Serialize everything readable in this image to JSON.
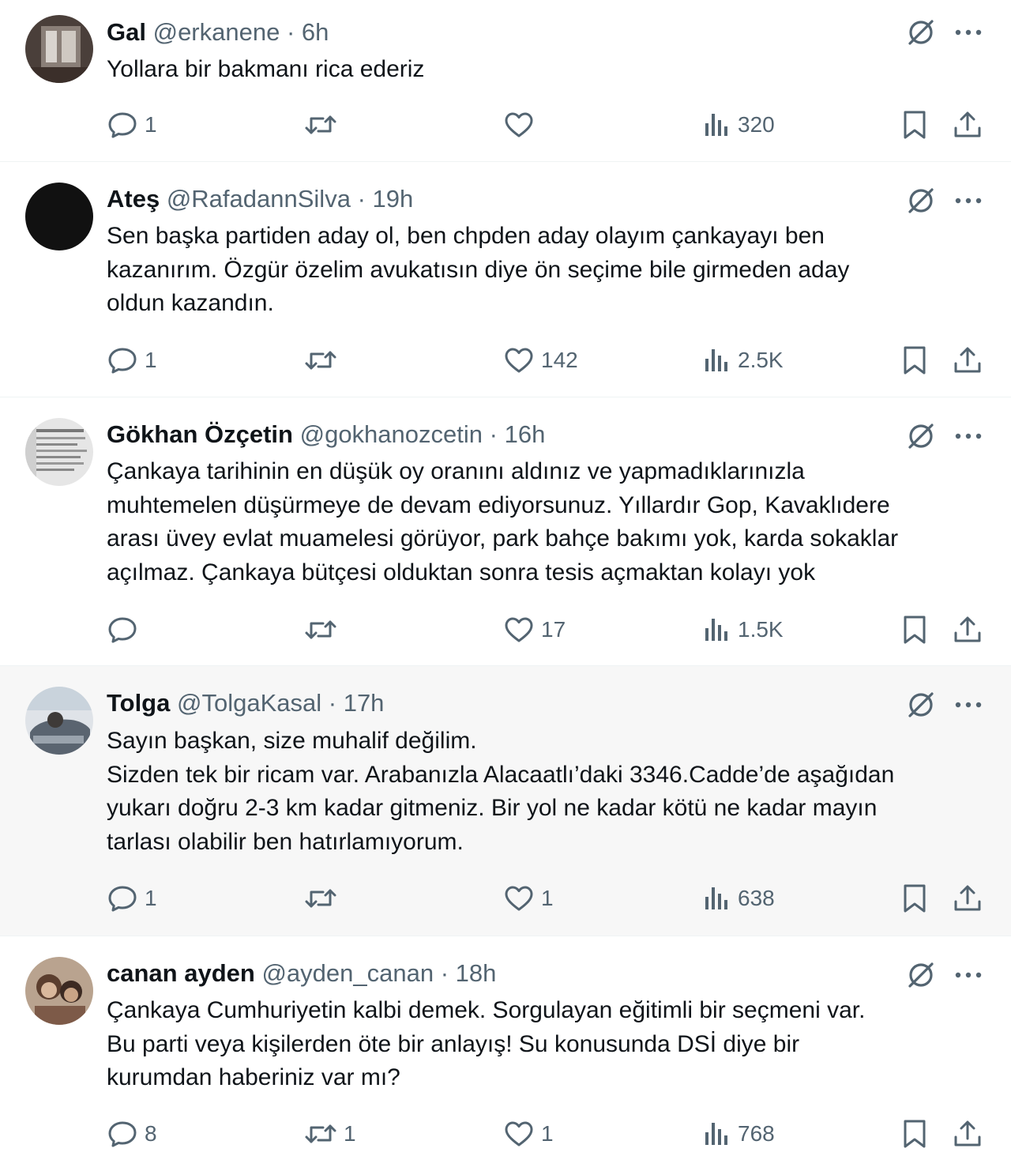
{
  "tweets": [
    {
      "name": "Gal",
      "handle": "@erkanene",
      "sep": "·",
      "time": "6h",
      "lines": [
        "Yollara bir bakmanı rica ederiz"
      ],
      "replies": "1",
      "retweets": "",
      "likes": "",
      "views": "320",
      "avatar": "photo"
    },
    {
      "name": "Ateş",
      "handle": "@RafadannSilva",
      "sep": "·",
      "time": "19h",
      "lines": [
        "Sen başka partiden aday ol, ben chpden aday olayım çankayayı ben",
        "kazanırım. Özgür özelim avukatısın diye ön seçime bile girmeden aday",
        "oldun kazandın."
      ],
      "replies": "1",
      "retweets": "",
      "likes": "142",
      "views": "2.5K",
      "avatar": "dark"
    },
    {
      "name": "Gökhan Özçetin",
      "handle": "@gokhanozcetin",
      "sep": "·",
      "time": "16h",
      "lines": [
        "Çankaya tarihinin en düşük oy oranını aldınız ve yapmadıklarınızla",
        "muhtemelen düşürmeye de devam ediyorsunuz. Yıllardır Gop, Kavaklıdere",
        "arası üvey evlat muamelesi görüyor, park bahçe bakımı yok, karda sokaklar",
        "açılmaz. Çankaya bütçesi olduktan sonra tesis açmaktan kolayı yok"
      ],
      "replies": "",
      "retweets": "",
      "likes": "17",
      "views": "1.5K",
      "avatar": "document"
    },
    {
      "name": "Tolga",
      "handle": "@TolgaKasal",
      "sep": "·",
      "time": "17h",
      "lines": [
        "Sayın başkan, size muhalif değilim.",
        "Sizden tek bir ricam var. Arabanızla Alacaatlı’daki 3346.Cadde’de aşağıdan",
        "yukarı doğru 2-3 km kadar gitmeniz. Bir yol ne kadar kötü ne kadar mayın",
        "tarlası olabilir ben hatırlamıyorum."
      ],
      "replies": "1",
      "retweets": "",
      "likes": "1",
      "views": "638",
      "avatar": "car"
    },
    {
      "name": "canan ayden",
      "handle": "@ayden_canan",
      "sep": "·",
      "time": "18h",
      "lines": [
        "Çankaya  Cumhuriyetin kalbi demek. Sorgulayan  eğitimli bir seçmeni var.",
        "Bu parti veya kişilerden öte bir anlayış! Su konusunda DSİ diye bir",
        "kurumdan haberiniz var mı?"
      ],
      "replies": "8",
      "retweets": "1",
      "likes": "1",
      "views": "768",
      "avatar": "people"
    }
  ],
  "colors": {
    "text": "#0f1419",
    "secondary": "#536471",
    "divider": "#eff3f4",
    "highlight": "#f7f7f7"
  },
  "icons": [
    "reply-icon",
    "retweet-icon",
    "like-icon",
    "views-icon",
    "bookmark-icon",
    "share-icon",
    "grok-icon",
    "more-icon"
  ]
}
